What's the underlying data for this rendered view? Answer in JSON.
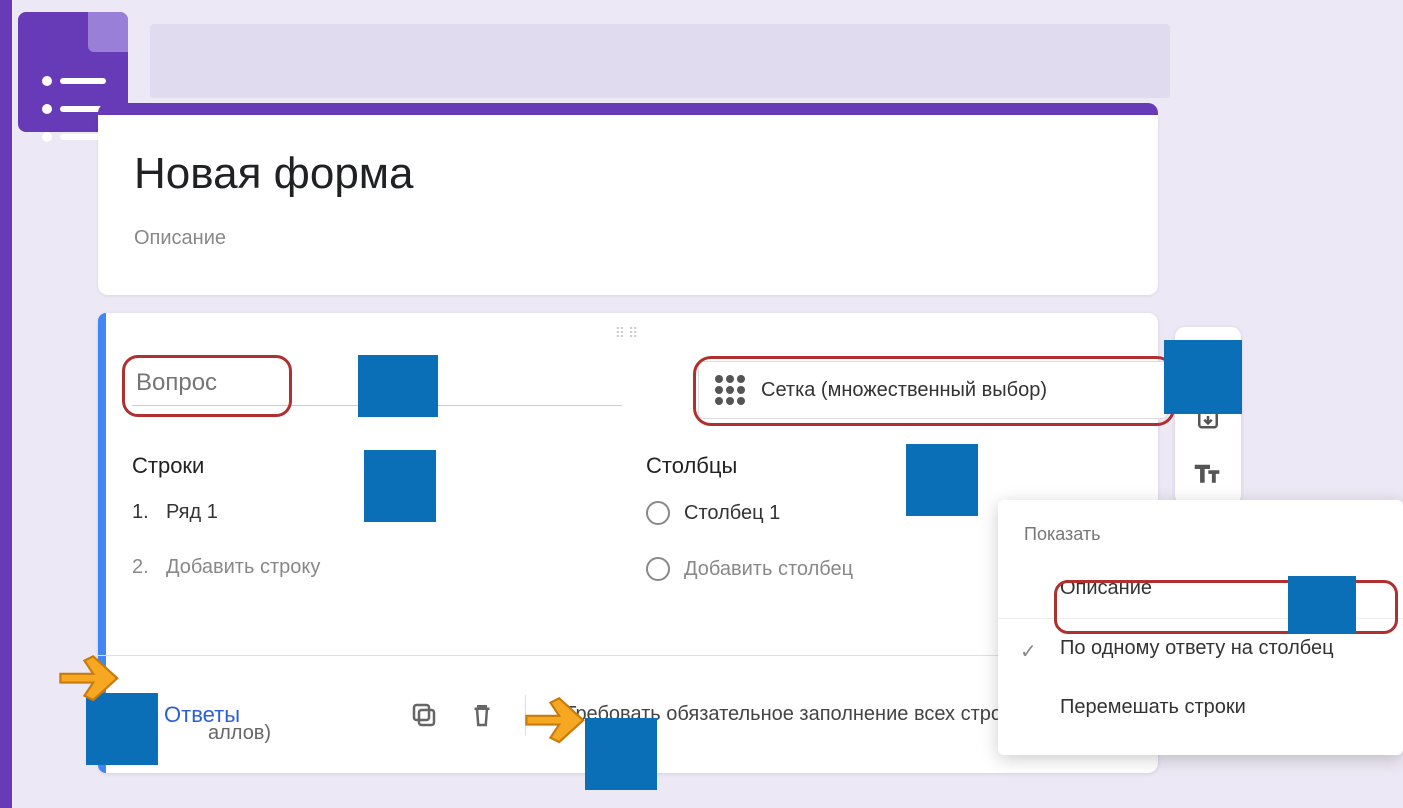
{
  "form": {
    "title": "Новая форма",
    "description": "Описание"
  },
  "question": {
    "placeholder": "Вопрос",
    "type_label": "Сетка (множественный выбор)",
    "rows_label": "Строки",
    "cols_label": "Столбцы",
    "rows": [
      "Ряд 1"
    ],
    "add_row": "Добавить строку",
    "cols": [
      "Столбец 1"
    ],
    "add_col": "Добавить столбец"
  },
  "footer": {
    "answers": "Ответы",
    "points_suffix": "аллов)",
    "required_label": "Требовать обязательное заполнение всех стро"
  },
  "side": {
    "add": "add-question",
    "import": "import-questions",
    "title_desc": "add-title"
  },
  "menu": {
    "header": "Показать",
    "items": [
      {
        "label": "Описание",
        "checked": false
      },
      {
        "label": "По одному ответу на столбец",
        "checked": true
      },
      {
        "label": "Перемешать строки",
        "checked": false
      }
    ]
  }
}
